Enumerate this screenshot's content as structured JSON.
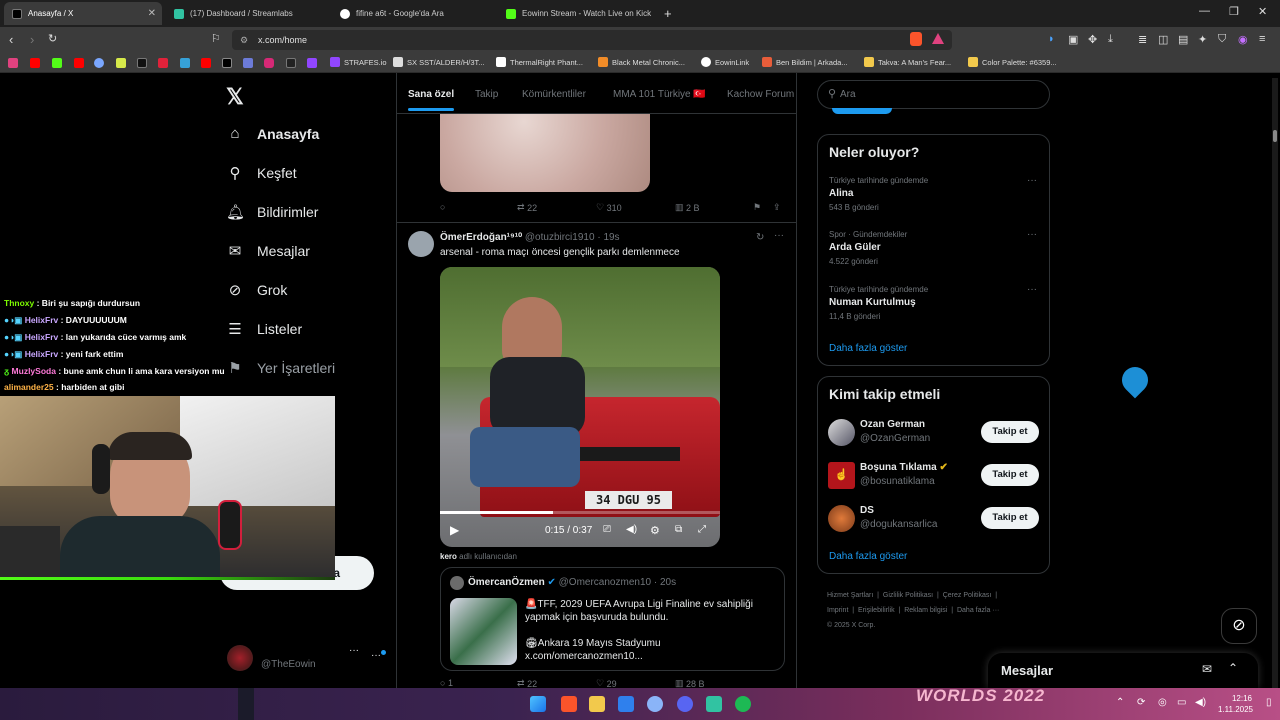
{
  "tabs": [
    {
      "title": "Anasayfa / X",
      "color": "#000000"
    },
    {
      "title": "(17) Dashboard / Streamlabs",
      "color": "#31c3a2"
    },
    {
      "title": "fifine a6t - Google'da Ara",
      "color": "#ffffff"
    },
    {
      "title": "Eowinn Stream - Watch Live on Kick",
      "color": "#53fc18"
    }
  ],
  "url": "x.com/home",
  "bookmarks": [
    "STRAFES.io",
    "SX SST/ALDER/H/3T...",
    "ThermalRight Phant...",
    "Black Metal Chronic...",
    "EowinLink",
    "Ben Bildim | Arkada...",
    "Takva: A Man's Fear...",
    "Color Palette: #6359..."
  ],
  "nav": {
    "home": "Anasayfa",
    "explore": "Keşfet",
    "notifications": "Bildirimler",
    "messages": "Mesajlar",
    "grok": "Grok",
    "lists": "Listeler",
    "bookmarks": "Yer İşaretleri",
    "profile_handle": "@TheEowin",
    "post_button_partial": "a"
  },
  "feed_tabs": [
    "Sana özel",
    "Takip",
    "Kömürkentliler",
    "MMA 101 Türkiye 🇹🇷",
    "Kachow Forum"
  ],
  "tweet1": {
    "replies": "",
    "retweets": "22",
    "likes": "310",
    "views": "2 B"
  },
  "tweet2": {
    "name": "ÖmerErdoğan¹⁹¹⁰",
    "handle": "@otuzbirci1910",
    "time": "19s",
    "text": "arsenal - roma maçı öncesi gençlik parkı demlenmece",
    "video_time": "0:15 / 0:37",
    "plate": "34 DGU 95",
    "reply_user": "kero",
    "reply_sub": "adlı kullanıcıdan",
    "quote": {
      "name": "ÖmercanÖzmen",
      "handle": "@Omercanozmen10",
      "time": "20s",
      "line1": "🚨TFF, 2029 UEFA Avrupa Ligi Finaline ev sahipliği",
      "line2": "yapmak için başvuruda bulundu.",
      "line3": "🏟Ankara 19 Mayıs Stadyumu",
      "line4": "x.com/omercanozmen10..."
    },
    "bottom_counts": [
      "1",
      "22",
      "29",
      "28 B"
    ]
  },
  "search": {
    "placeholder": "Ara"
  },
  "trends": {
    "title": "Neler oluyor?",
    "items": [
      {
        "category": "Türkiye tarihinde gündemde",
        "name": "Alina",
        "count": "543 B gönderi"
      },
      {
        "category": "Spor · Gündemdekiler",
        "name": "Arda Güler",
        "count": "4.522 gönderi"
      },
      {
        "category": "Türkiye tarihinde gündemde",
        "name": "Numan Kurtulmuş",
        "count": "11,4 B gönderi"
      }
    ],
    "more": "Daha fazla göster"
  },
  "who_to_follow": {
    "title": "Kimi takip etmeli",
    "items": [
      {
        "name": "Ozan German",
        "handle": "@OzanGerman",
        "button": "Takip et"
      },
      {
        "name": "Boşuna Tıklama",
        "handle": "@bosunatiklama",
        "button": "Takip et"
      },
      {
        "name": "DS",
        "handle": "@dogukansarlica",
        "button": "Takip et"
      }
    ],
    "more": "Daha fazla göster"
  },
  "footer": {
    "l1a": "Hizmet Şartları",
    "l1b": "Gizlilik Politikası",
    "l1c": "Çerez Politikası",
    "l2a": "Imprint",
    "l2b": "Erişilebilirlik",
    "l2c": "Reklam bilgisi",
    "l2d": "Daha fazla ···",
    "copy": "© 2025 X Corp."
  },
  "messages_drawer": "Mesajlar",
  "chat": [
    {
      "user": "Thnoxy",
      "msg": ": Biri şu sapığı durdursun",
      "color": "#7CFC00"
    },
    {
      "user": "HelixFrv",
      "msg": ": DAYUUUUUUM",
      "color": "#c9a7ff"
    },
    {
      "user": "HelixFrv",
      "msg": ": lan yukarıda cüce varmış amk",
      "color": "#c9a7ff"
    },
    {
      "user": "HelixFrv",
      "msg": ": yeni fark ettim",
      "color": "#c9a7ff"
    },
    {
      "user": "MuzlySoda",
      "msg": ": bune amk chun li ama kara versiyon mu",
      "color": "#ff7ad9"
    },
    {
      "user": "alimander25",
      "msg": ": harbiden at gibi",
      "color": "#ffb347"
    }
  ],
  "clock": {
    "time": "12:16",
    "date": "1.11.2025"
  },
  "taskbar_banner": "WORLDS 2022"
}
